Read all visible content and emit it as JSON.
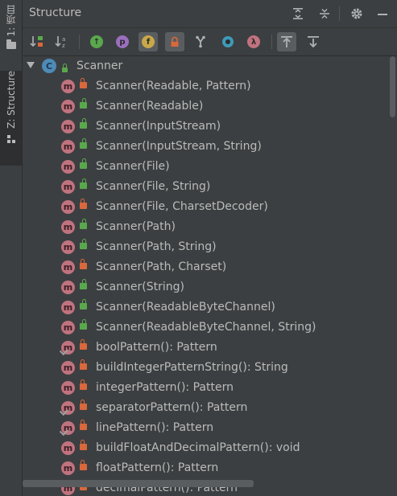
{
  "tool_strip": {
    "projects_label": "1: 项目",
    "structure_label": "Z: Structure"
  },
  "header": {
    "title": "Structure"
  },
  "toolbar": {
    "field_letter": "f",
    "property_letter": "p",
    "lambda_glyph": "λ",
    "inherited_glyph": "↑"
  },
  "tree": {
    "root": {
      "label": "Scanner",
      "icon_letter": "C"
    },
    "method_letter": "m",
    "members": [
      {
        "label": "Scanner(Readable, Pattern)",
        "visibility": "private",
        "override": false
      },
      {
        "label": "Scanner(Readable)",
        "visibility": "public",
        "override": false
      },
      {
        "label": "Scanner(InputStream)",
        "visibility": "public",
        "override": false
      },
      {
        "label": "Scanner(InputStream, String)",
        "visibility": "public",
        "override": false
      },
      {
        "label": "Scanner(File)",
        "visibility": "public",
        "override": false
      },
      {
        "label": "Scanner(File, String)",
        "visibility": "public",
        "override": false
      },
      {
        "label": "Scanner(File, CharsetDecoder)",
        "visibility": "private",
        "override": false
      },
      {
        "label": "Scanner(Path)",
        "visibility": "public",
        "override": false
      },
      {
        "label": "Scanner(Path, String)",
        "visibility": "public",
        "override": false
      },
      {
        "label": "Scanner(Path, Charset)",
        "visibility": "private",
        "override": false
      },
      {
        "label": "Scanner(String)",
        "visibility": "public",
        "override": false
      },
      {
        "label": "Scanner(ReadableByteChannel)",
        "visibility": "public",
        "override": false
      },
      {
        "label": "Scanner(ReadableByteChannel, String)",
        "visibility": "public",
        "override": false
      },
      {
        "label": "boolPattern(): Pattern",
        "visibility": "private",
        "override": true
      },
      {
        "label": "buildIntegerPatternString(): String",
        "visibility": "private",
        "override": false
      },
      {
        "label": "integerPattern(): Pattern",
        "visibility": "private",
        "override": false
      },
      {
        "label": "separatorPattern(): Pattern",
        "visibility": "private",
        "override": true
      },
      {
        "label": "linePattern(): Pattern",
        "visibility": "private",
        "override": true
      },
      {
        "label": "buildFloatAndDecimalPattern(): void",
        "visibility": "private",
        "override": false
      },
      {
        "label": "floatPattern(): Pattern",
        "visibility": "private",
        "override": false
      },
      {
        "label": "decimalPattern(): Pattern",
        "visibility": "private",
        "override": false
      }
    ]
  },
  "colors": {
    "background": "#3c3f41",
    "text": "#bbbbbb",
    "method_icon": "#c0737f",
    "class_icon": "#4e8bb7",
    "public": "#5aa84d",
    "private": "#d9683c"
  }
}
